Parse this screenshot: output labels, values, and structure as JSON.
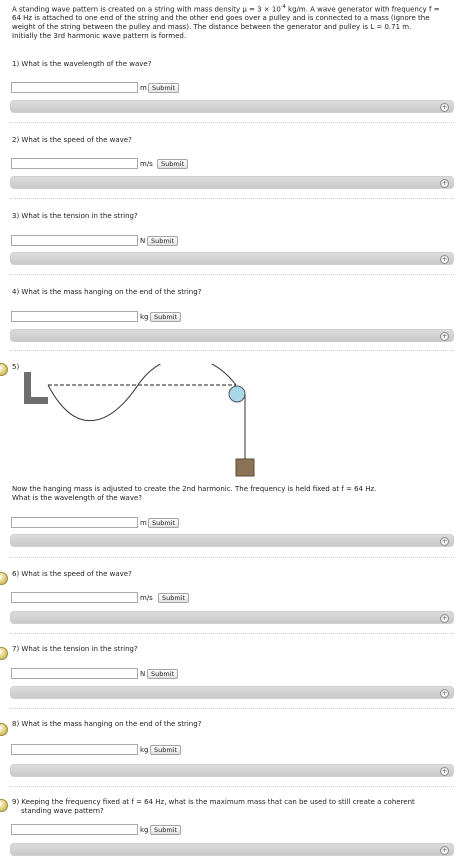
{
  "intro": {
    "line1_a": "A standing wave pattern is created on a string with mass density μ = 3 × 10",
    "line1_exp": "-4",
    "line1_b": " kg/m. A wave generator with frequency f =",
    "line2": "64 Hz is attached to one end of the string and the other end goes over a pulley and is connected to a mass (ignore the",
    "line3": "weight of the string between the pulley and mass). The distance between the generator and pulley is L = 0.71 m.",
    "line4": "Initially the 3rd harmonic wave pattern is formed."
  },
  "submit_label": "Submit",
  "questions": [
    {
      "text": "1) What is the wavelength of the wave?",
      "unit": "m"
    },
    {
      "text": "2) What is the speed of the wave?",
      "unit": "m/s"
    },
    {
      "text": "3) What is the tension in the string?",
      "unit": "N"
    },
    {
      "text": "4) What is the mass hanging on the end of the string?",
      "unit": "kg"
    },
    {
      "label": "5)",
      "text1": "Now the hanging mass is adjusted to create the 2nd harmonic. The frequency is held fixed at f = 64 Hz.",
      "text2": "What is the wavelength of the wave?",
      "unit": "m"
    },
    {
      "text": "6) What is the speed of the wave?",
      "unit": "m/s"
    },
    {
      "text": "7) What is the tension in the string?",
      "unit": "N"
    },
    {
      "text": "8) What is the mass hanging on the end of the string?",
      "unit": "kg"
    },
    {
      "text1": "9) Keeping the frequency fixed at f = 64 Hz, what is the maximum mass that can be used to still create a coherent",
      "text2": "standing wave pattern?",
      "unit": "kg"
    }
  ],
  "plus_symbol": "+"
}
